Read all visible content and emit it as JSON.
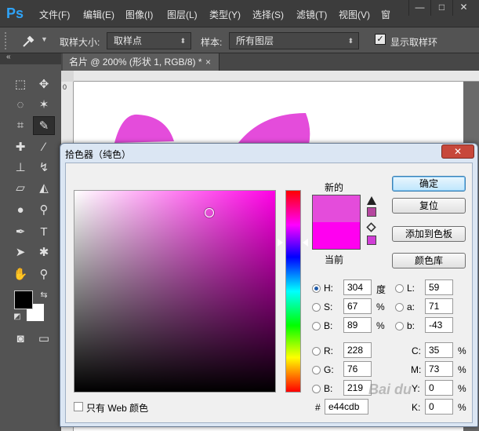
{
  "app": {
    "logo": "Ps",
    "menu": [
      "文件(F)",
      "编辑(E)",
      "图像(I)",
      "图层(L)",
      "类型(Y)",
      "选择(S)",
      "滤镜(T)",
      "视图(V)",
      "窗"
    ],
    "window_buttons": [
      "—",
      "□",
      "✕"
    ]
  },
  "options_bar": {
    "sample_size_label": "取样大小:",
    "sample_size_value": "取样点",
    "sample_label": "样本:",
    "sample_value": "所有图层",
    "show_ring_label": "显示取样环",
    "show_ring_checked": true
  },
  "document": {
    "tab_title": "名片 @ 200% (形状 1, RGB/8) *",
    "tab_close": "×",
    "ruler_zero": "0"
  },
  "shape_color": "#e44cdb",
  "color_picker": {
    "title": "拾色器（纯色）",
    "new_label": "新的",
    "current_label": "当前",
    "new_color": "#e44cdb",
    "current_color": "#ff00f0",
    "gamut_warning_color": "#b5479f",
    "web_safe_color": "#d03ed6",
    "buttons": {
      "ok": "确定",
      "reset": "复位",
      "add_to_swatches": "添加到色板",
      "color_libraries": "颜色库"
    },
    "hsb": {
      "h_label": "H:",
      "h_value": "304",
      "h_unit": "度",
      "s_label": "S:",
      "s_value": "67",
      "s_unit": "%",
      "b_label": "B:",
      "b_value": "89",
      "b_unit": "%",
      "selected": "H"
    },
    "lab": {
      "l_label": "L:",
      "l_value": "59",
      "a_label": "a:",
      "a_value": "71",
      "b_label": "b:",
      "b_value": "-43"
    },
    "rgb": {
      "r_label": "R:",
      "r_value": "228",
      "g_label": "G:",
      "g_value": "76",
      "b_label": "B:",
      "b_value": "219"
    },
    "cmyk": {
      "c_label": "C:",
      "c_value": "35",
      "c_unit": "%",
      "m_label": "M:",
      "m_value": "73",
      "m_unit": "%",
      "y_label": "Y:",
      "y_value": "0",
      "y_unit": "%",
      "k_label": "K:",
      "k_value": "0",
      "k_unit": "%"
    },
    "hex_label": "#",
    "hex_value": "e44cdb",
    "web_only_label": "只有 Web 颜色",
    "web_only_checked": false
  },
  "watermark": "Bai du"
}
